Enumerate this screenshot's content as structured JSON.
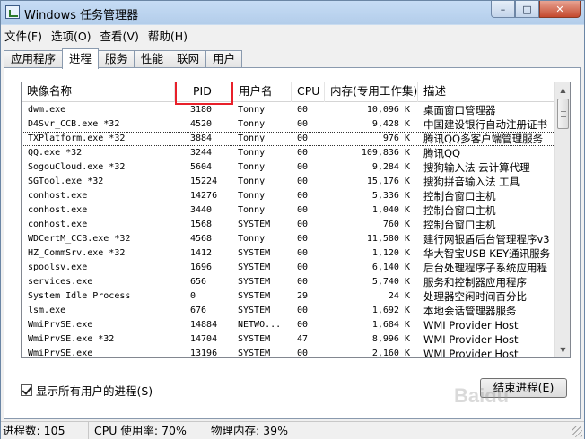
{
  "window": {
    "title": "Windows 任务管理器",
    "caption_minimize": "–",
    "caption_maximize": "□",
    "caption_close": "✕"
  },
  "menu": [
    "文件(F)",
    "选项(O)",
    "查看(V)",
    "帮助(H)"
  ],
  "tabs": [
    "应用程序",
    "进程",
    "服务",
    "性能",
    "联网",
    "用户"
  ],
  "active_tab": "进程",
  "columns": [
    "映像名称",
    "PID",
    "用户名",
    "CPU",
    "内存(专用工作集)",
    "描述"
  ],
  "highlight_color": "#e8202a",
  "processes": [
    {
      "name": "dwm.exe",
      "pid": "3180",
      "user": "Tonny",
      "cpu": "00",
      "mem": "10,096 K",
      "desc": "桌面窗口管理器"
    },
    {
      "name": "D4Svr_CCB.exe *32",
      "pid": "4520",
      "user": "Tonny",
      "cpu": "00",
      "mem": "9,428 K",
      "desc": "中国建设银行自动注册证书"
    },
    {
      "name": "TXPlatform.exe *32",
      "pid": "3884",
      "user": "Tonny",
      "cpu": "00",
      "mem": "976 K",
      "desc": "腾讯QQ多客户端管理服务"
    },
    {
      "name": "QQ.exe *32",
      "pid": "3244",
      "user": "Tonny",
      "cpu": "00",
      "mem": "109,836 K",
      "desc": "腾讯QQ"
    },
    {
      "name": "SogouCloud.exe *32",
      "pid": "5604",
      "user": "Tonny",
      "cpu": "00",
      "mem": "9,284 K",
      "desc": "搜狗输入法 云计算代理"
    },
    {
      "name": "SGTool.exe *32",
      "pid": "15224",
      "user": "Tonny",
      "cpu": "00",
      "mem": "15,176 K",
      "desc": "搜狗拼音输入法 工具"
    },
    {
      "name": "conhost.exe",
      "pid": "14276",
      "user": "Tonny",
      "cpu": "00",
      "mem": "5,336 K",
      "desc": "控制台窗口主机"
    },
    {
      "name": "conhost.exe",
      "pid": "3440",
      "user": "Tonny",
      "cpu": "00",
      "mem": "1,040 K",
      "desc": "控制台窗口主机"
    },
    {
      "name": "conhost.exe",
      "pid": "1568",
      "user": "SYSTEM",
      "cpu": "00",
      "mem": "760 K",
      "desc": "控制台窗口主机"
    },
    {
      "name": "WDCertM_CCB.exe *32",
      "pid": "4568",
      "user": "Tonny",
      "cpu": "00",
      "mem": "11,580 K",
      "desc": "建行网银盾后台管理程序v3"
    },
    {
      "name": "HZ_CommSrv.exe *32",
      "pid": "1412",
      "user": "SYSTEM",
      "cpu": "00",
      "mem": "1,120 K",
      "desc": "华大智宝USB KEY通讯服务"
    },
    {
      "name": "spoolsv.exe",
      "pid": "1696",
      "user": "SYSTEM",
      "cpu": "00",
      "mem": "6,140 K",
      "desc": "后台处理程序子系统应用程"
    },
    {
      "name": "services.exe",
      "pid": "656",
      "user": "SYSTEM",
      "cpu": "00",
      "mem": "5,740 K",
      "desc": "服务和控制器应用程序"
    },
    {
      "name": "System Idle Process",
      "pid": "0",
      "user": "SYSTEM",
      "cpu": "29",
      "mem": "24 K",
      "desc": "处理器空闲时间百分比"
    },
    {
      "name": "lsm.exe",
      "pid": "676",
      "user": "SYSTEM",
      "cpu": "00",
      "mem": "1,692 K",
      "desc": "本地会话管理器服务"
    },
    {
      "name": "WmiPrvSE.exe",
      "pid": "14884",
      "user": "NETWO...",
      "cpu": "00",
      "mem": "1,684 K",
      "desc": "WMI Provider Host"
    },
    {
      "name": "WmiPrvSE.exe *32",
      "pid": "14704",
      "user": "SYSTEM",
      "cpu": "47",
      "mem": "8,996 K",
      "desc": "WMI Provider Host"
    },
    {
      "name": "WmiPrvSE.exe",
      "pid": "13196",
      "user": "SYSTEM",
      "cpu": "00",
      "mem": "2,160 K",
      "desc": "WMI Provider Host"
    }
  ],
  "show_all_label": "显示所有用户的进程(S)",
  "end_process_label": "结束进程(E)",
  "watermark": "Baidu",
  "status": {
    "processes": "进程数: 105",
    "cpu": "CPU 使用率: 70%",
    "memory": "物理内存: 39%"
  }
}
